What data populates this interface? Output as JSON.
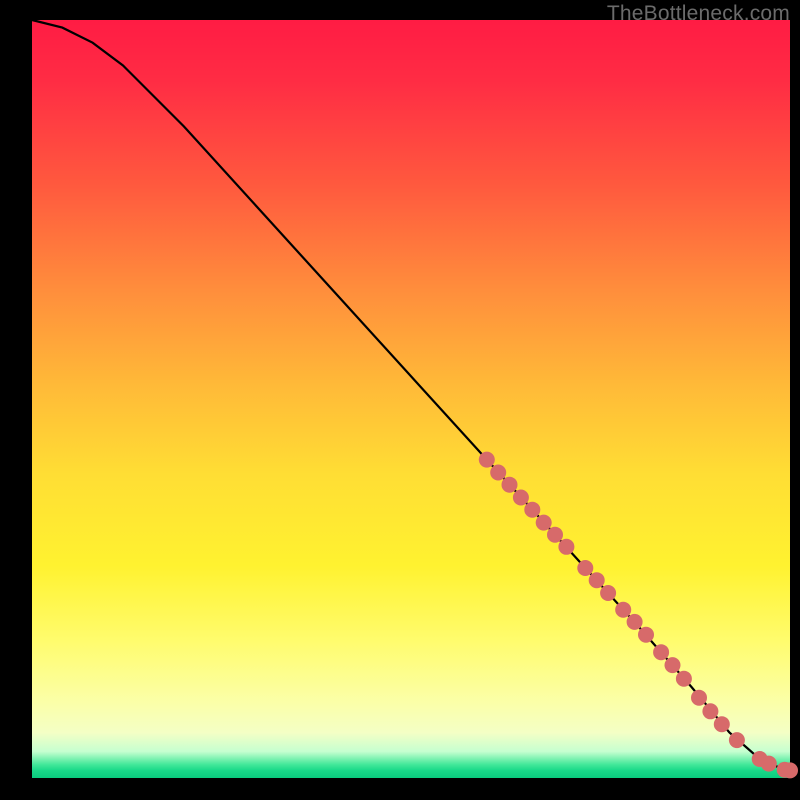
{
  "watermark": "TheBottleneck.com",
  "chart_data": {
    "type": "line",
    "title": "",
    "xlabel": "",
    "ylabel": "",
    "xlim": [
      0,
      100
    ],
    "ylim": [
      0,
      100
    ],
    "curve": {
      "x": [
        0,
        4,
        8,
        12,
        20,
        30,
        40,
        50,
        60,
        70,
        80,
        87,
        92,
        96,
        99,
        100
      ],
      "y": [
        100,
        99,
        97,
        94,
        86,
        75,
        64,
        53,
        42,
        31,
        20,
        12,
        6,
        2.5,
        1.2,
        1
      ]
    },
    "markers": {
      "color": "#d76a6a",
      "radius_px": 8,
      "points": [
        {
          "x": 60.0,
          "y": 42.0
        },
        {
          "x": 61.5,
          "y": 40.3
        },
        {
          "x": 63.0,
          "y": 38.7
        },
        {
          "x": 64.5,
          "y": 37.0
        },
        {
          "x": 66.0,
          "y": 35.4
        },
        {
          "x": 67.5,
          "y": 33.7
        },
        {
          "x": 69.0,
          "y": 32.1
        },
        {
          "x": 70.5,
          "y": 30.5
        },
        {
          "x": 73.0,
          "y": 27.7
        },
        {
          "x": 74.5,
          "y": 26.1
        },
        {
          "x": 76.0,
          "y": 24.4
        },
        {
          "x": 78.0,
          "y": 22.2
        },
        {
          "x": 79.5,
          "y": 20.6
        },
        {
          "x": 81.0,
          "y": 18.9
        },
        {
          "x": 83.0,
          "y": 16.6
        },
        {
          "x": 84.5,
          "y": 14.9
        },
        {
          "x": 86.0,
          "y": 13.1
        },
        {
          "x": 88.0,
          "y": 10.6
        },
        {
          "x": 89.5,
          "y": 8.8
        },
        {
          "x": 91.0,
          "y": 7.1
        },
        {
          "x": 93.0,
          "y": 5.0
        },
        {
          "x": 96.0,
          "y": 2.5
        },
        {
          "x": 97.2,
          "y": 1.9
        },
        {
          "x": 99.3,
          "y": 1.1
        },
        {
          "x": 100.0,
          "y": 1.0
        }
      ]
    }
  }
}
